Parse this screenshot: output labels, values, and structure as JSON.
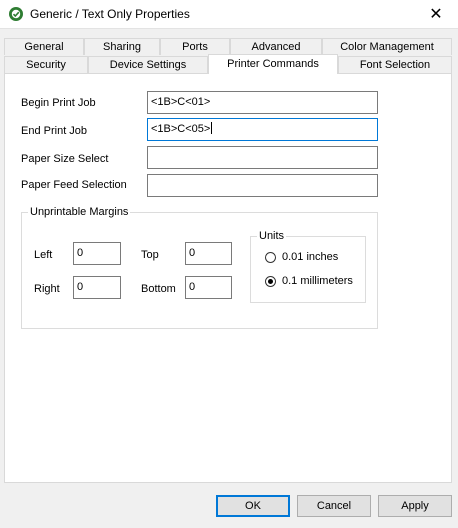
{
  "window": {
    "title": "Generic / Text Only Properties",
    "close_glyph": "✕"
  },
  "tabs": {
    "row1": [
      {
        "label": "General"
      },
      {
        "label": "Sharing"
      },
      {
        "label": "Ports"
      },
      {
        "label": "Advanced"
      },
      {
        "label": "Color Management"
      }
    ],
    "row2": [
      {
        "label": "Security"
      },
      {
        "label": "Device Settings"
      },
      {
        "label": "Printer Commands",
        "active": true
      },
      {
        "label": "Font Selection"
      }
    ]
  },
  "commands": {
    "begin_print_job": {
      "label": "Begin Print Job",
      "value": "<1B>C<01>"
    },
    "end_print_job": {
      "label": "End Print Job",
      "value": "<1B>C<05>"
    },
    "paper_size_select": {
      "label": "Paper Size Select",
      "value": ""
    },
    "paper_feed_selection": {
      "label": "Paper Feed Selection",
      "value": ""
    }
  },
  "margins": {
    "group_title": "Unprintable Margins",
    "left": {
      "label": "Left",
      "value": "0"
    },
    "top": {
      "label": "Top",
      "value": "0"
    },
    "right": {
      "label": "Right",
      "value": "0"
    },
    "bottom": {
      "label": "Bottom",
      "value": "0"
    }
  },
  "units": {
    "group_title": "Units",
    "options": [
      {
        "label": "0.01 inches",
        "checked": false
      },
      {
        "label": "0.1 millimeters",
        "checked": true
      }
    ]
  },
  "buttons": {
    "ok": "OK",
    "cancel": "Cancel",
    "apply": "Apply"
  },
  "colors": {
    "focus_accent": "#0078d7",
    "dialog_background": "#f0f0f0",
    "panel_background": "#ffffff"
  }
}
